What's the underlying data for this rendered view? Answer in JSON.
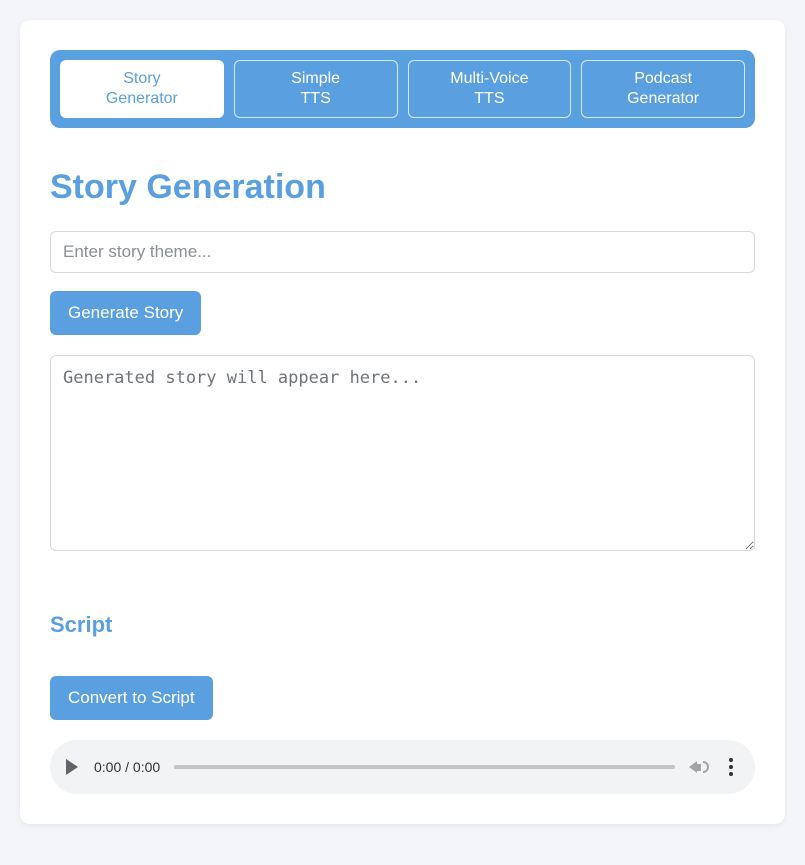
{
  "tabs": [
    {
      "label": "Story\nGenerator",
      "active": true
    },
    {
      "label": "Simple\nTTS",
      "active": false
    },
    {
      "label": "Multi-Voice\nTTS",
      "active": false
    },
    {
      "label": "Podcast\nGenerator",
      "active": false
    }
  ],
  "heading": "Story Generation",
  "theme_input": {
    "placeholder": "Enter story theme...",
    "value": ""
  },
  "generate_button": "Generate Story",
  "story_output": {
    "placeholder": "Generated story will appear here...",
    "value": ""
  },
  "script_section": {
    "title": "Script",
    "button": "Convert to Script"
  },
  "audio": {
    "current": "0:00",
    "total": "0:00"
  }
}
